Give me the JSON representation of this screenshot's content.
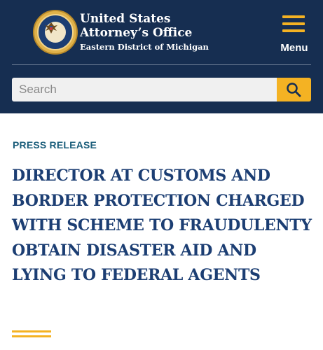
{
  "header": {
    "agency_line1": "United States",
    "agency_line2": "Attorney’s Office",
    "district": "Eastern District of Michigan",
    "menu_label": "Menu",
    "seal_icon": "doj-seal-icon",
    "menu_icon": "hamburger-icon"
  },
  "search": {
    "placeholder": "Search",
    "button_icon": "search-icon"
  },
  "article": {
    "kicker": "PRESS RELEASE",
    "headline": "DIRECTOR AT CUSTOMS AND BORDER PROTECTION CHARGED WITH SCHEME TO FRAUDULENTY OBTAIN DISASTER AID AND LYING TO FEDERAL AGENTS"
  },
  "colors": {
    "navy": "#162e51",
    "gold": "#f4b223",
    "headline": "#1c3e73",
    "kicker": "#1a5d7a"
  }
}
